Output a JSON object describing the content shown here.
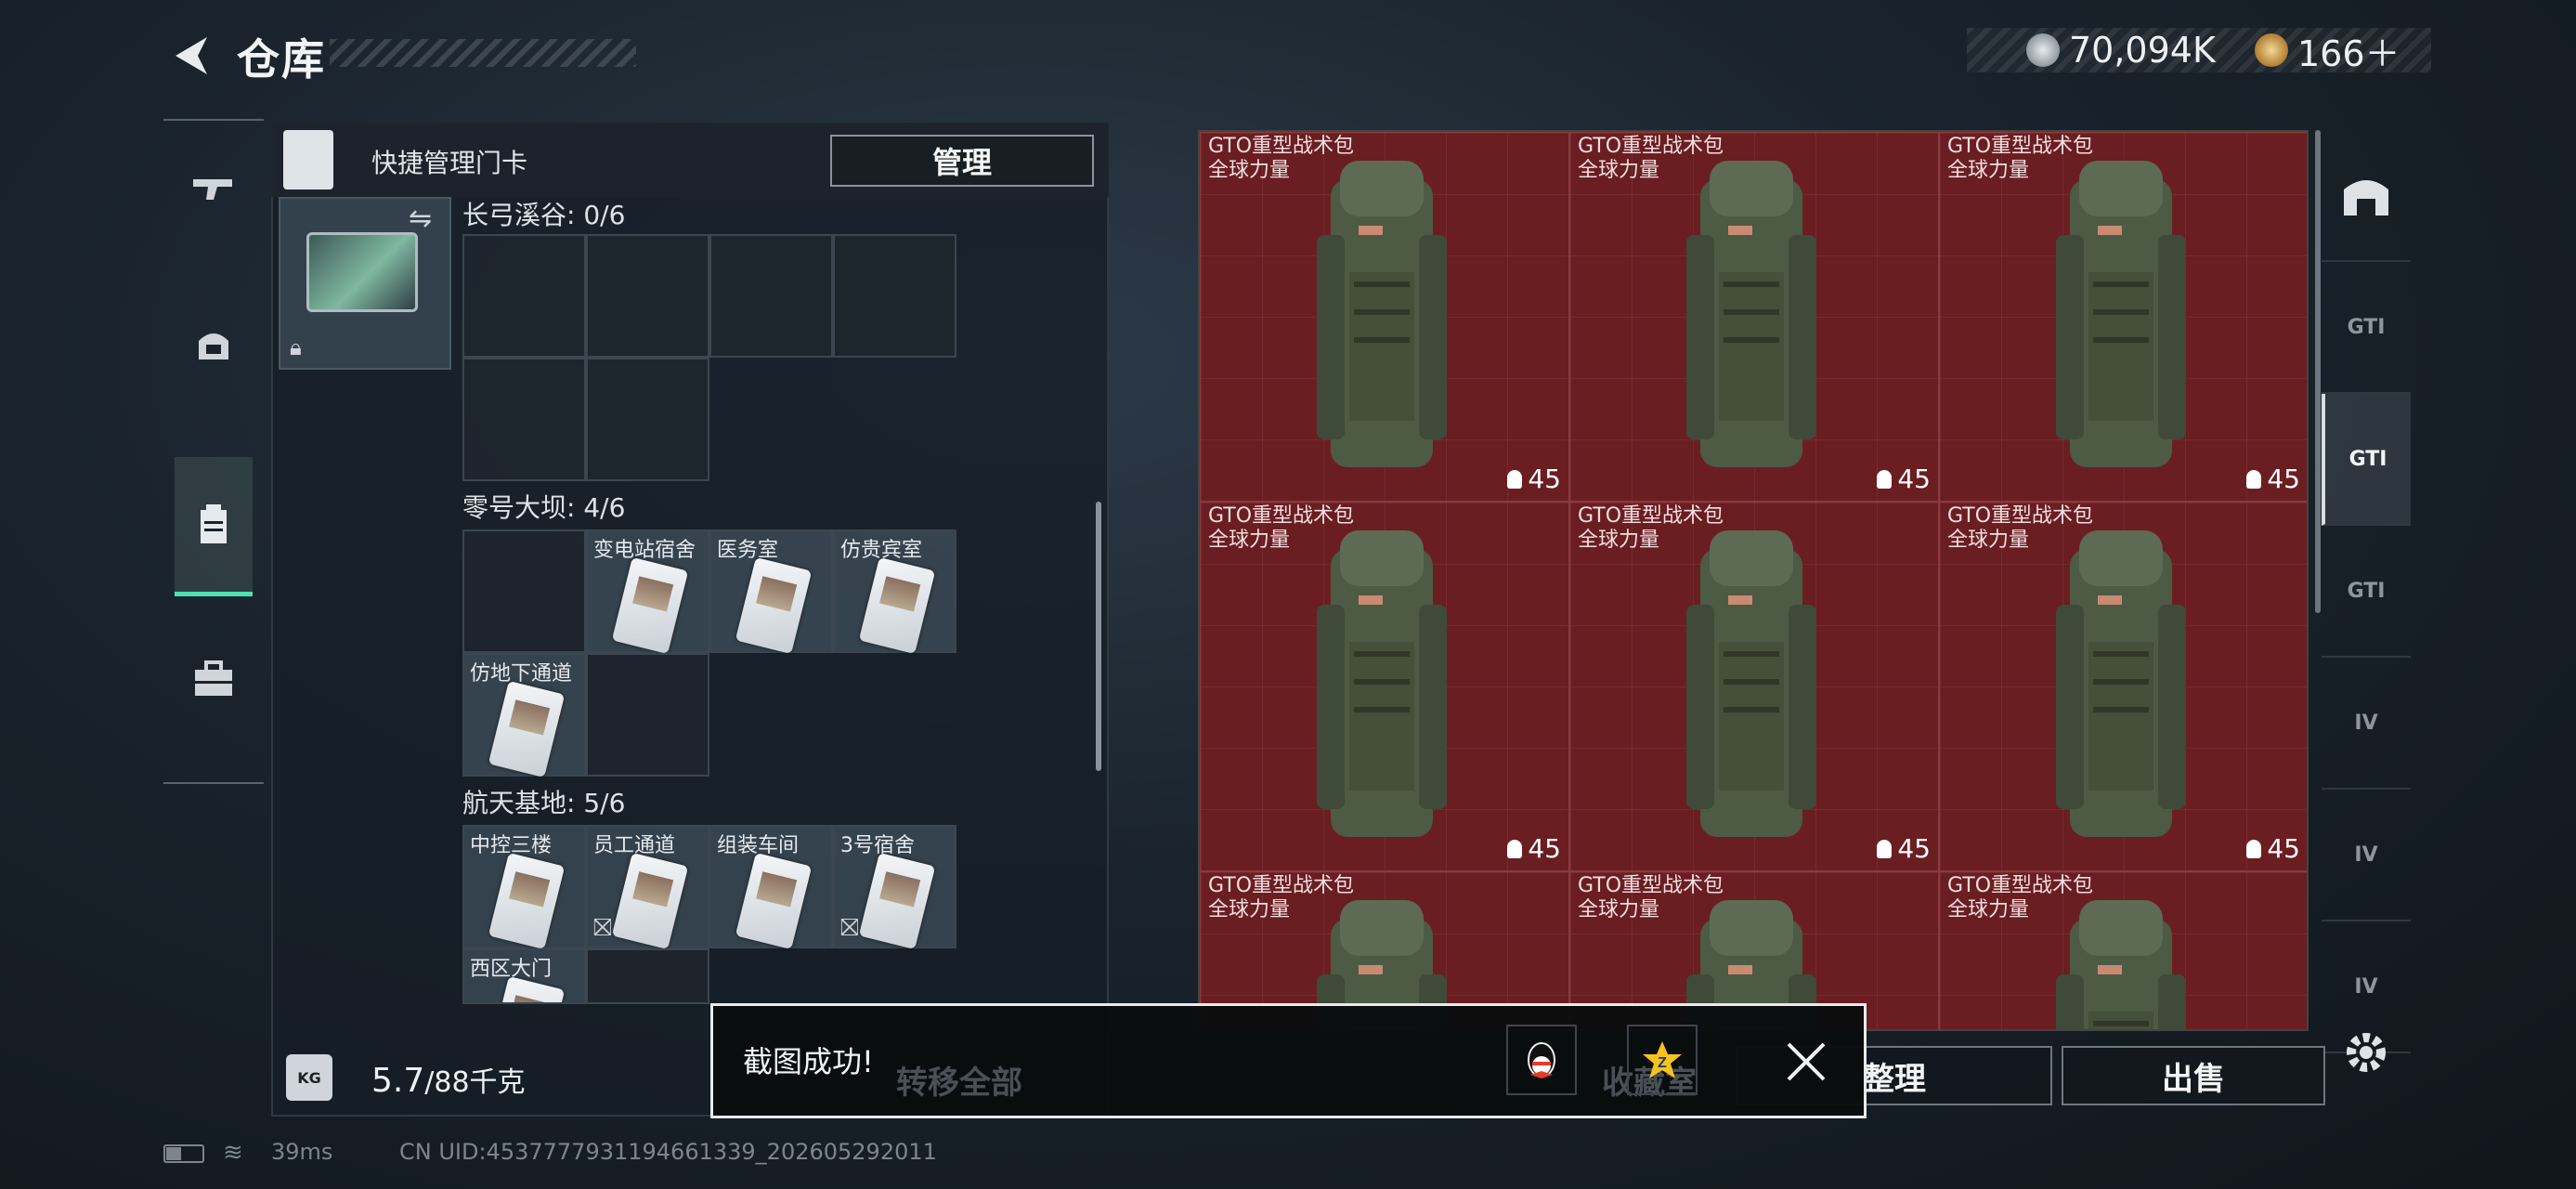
{
  "header": {
    "title": "仓库",
    "currency1": "70,094K",
    "currency2": "166＋"
  },
  "left_nav": {
    "items": [
      "weapons",
      "equipment",
      "keycards",
      "toolbox"
    ],
    "active": 2
  },
  "panel": {
    "header_label": "快捷管理门卡",
    "manage_button": "管理",
    "sections": [
      {
        "title": "长弓溪谷: 0/6"
      },
      {
        "title": "零号大坝: 4/6",
        "cards": [
          "变电站宿舍",
          "医务室",
          "仿贵宾室",
          "仿地下通道"
        ]
      },
      {
        "title": "航天基地: 5/6",
        "cards": [
          "中控三楼",
          "员工通道",
          "组装车间",
          "3号宿舍",
          "西区大门"
        ]
      }
    ],
    "weight_icon": "KG",
    "weight_value": "5.7",
    "weight_max": "/88千克"
  },
  "grid": {
    "item_name": "GTO重型战术包",
    "item_brand": "全球力量",
    "item_durability": "45",
    "count": 9
  },
  "right_nav": {
    "labels": [
      "",
      "GTI",
      "GTI",
      "GTI",
      "IV",
      "IV",
      "IV"
    ],
    "active": 2
  },
  "bottom": {
    "transfer_all": "转移全部",
    "collect": "收藏室",
    "sort": "整理",
    "sell": "出售"
  },
  "toast": {
    "message": "截图成功!"
  },
  "status": {
    "ping": "39ms",
    "uid": "CN UID:4537777931194661339_202605292011"
  }
}
